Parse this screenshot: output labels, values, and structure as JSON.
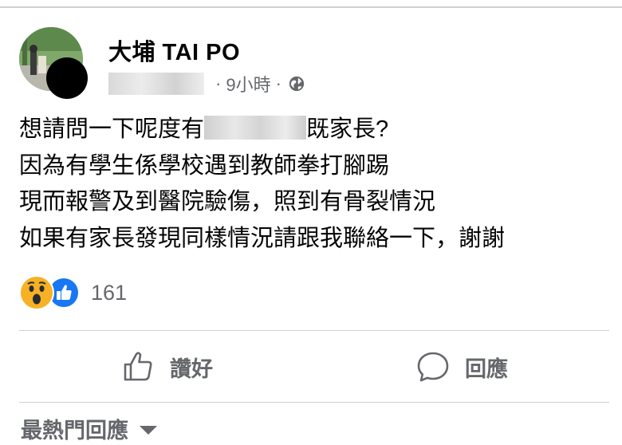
{
  "post": {
    "page_name": "大埔 TAI PO",
    "time": "9小時",
    "separator": "·",
    "privacy_icon": "globe-icon",
    "body": {
      "line1_before": "想請問一下呢度有",
      "line1_after": "既家長?",
      "line2": "因為有學生係學校遇到教師拳打腳踢",
      "line3": "現而報警及到醫院驗傷，照到有骨裂情況",
      "line4": "如果有家長發現同樣情況請跟我聯絡一下，謝謝"
    }
  },
  "reactions": {
    "icons": [
      "wow-reaction-icon",
      "like-reaction-icon"
    ],
    "count": "161"
  },
  "actions": {
    "like_label": "讚好",
    "comment_label": "回應"
  },
  "comments": {
    "sort_label": "最熱門回應"
  },
  "colors": {
    "text_primary": "#050505",
    "text_secondary": "#65676b",
    "like_blue": "#1877f2",
    "wow_yellow": "#f7b125",
    "divider": "#ced0d4"
  }
}
